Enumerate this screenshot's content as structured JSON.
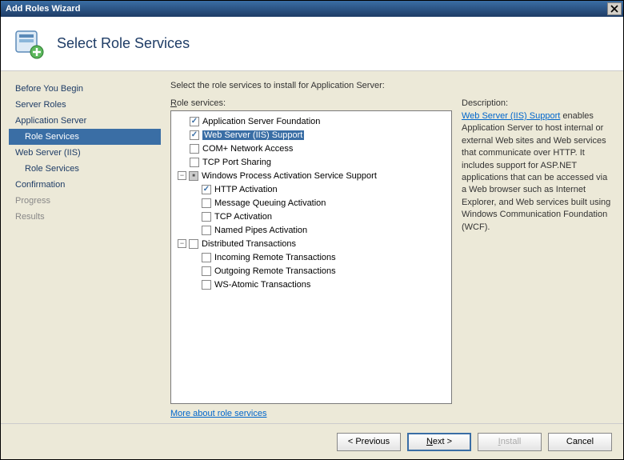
{
  "window": {
    "title": "Add Roles Wizard"
  },
  "header": {
    "title": "Select Role Services"
  },
  "sidebar": {
    "items": [
      {
        "label": "Before You Begin",
        "cls": ""
      },
      {
        "label": "Server Roles",
        "cls": ""
      },
      {
        "label": "Application Server",
        "cls": ""
      },
      {
        "label": "Role Services",
        "cls": "selected sub"
      },
      {
        "label": "Web Server (IIS)",
        "cls": ""
      },
      {
        "label": "Role Services",
        "cls": "sub"
      },
      {
        "label": "Confirmation",
        "cls": ""
      },
      {
        "label": "Progress",
        "cls": "gray"
      },
      {
        "label": "Results",
        "cls": "gray"
      }
    ]
  },
  "main": {
    "instruction": "Select the role services to install for Application Server:",
    "tree_label_pre": "R",
    "tree_label_post": "ole services:",
    "desc_label": "Description:",
    "desc_link": "Web Server (IIS) Support",
    "desc_text": " enables Application Server to host internal or external Web sites and Web services that communicate over HTTP. It includes support for ASP.NET applications that can be accessed via a Web browser such as Internet Explorer, and Web services built using Windows Communication Foundation (WCF).",
    "more_link": "More about role services",
    "tree": [
      {
        "label": "Application Server Foundation",
        "indent": "indent1",
        "check": "checked",
        "exp": "space"
      },
      {
        "label": "Web Server (IIS) Support",
        "indent": "indent1",
        "check": "checked",
        "exp": "space",
        "highlight": true
      },
      {
        "label": "COM+ Network Access",
        "indent": "indent1",
        "check": "",
        "exp": "space"
      },
      {
        "label": "TCP Port Sharing",
        "indent": "indent1",
        "check": "",
        "exp": "space"
      },
      {
        "label": "Windows Process Activation Service Support",
        "indent": "",
        "check": "indeterminate",
        "exp": "minus"
      },
      {
        "label": "HTTP Activation",
        "indent": "indent2",
        "check": "checked",
        "exp": "space"
      },
      {
        "label": "Message Queuing Activation",
        "indent": "indent2",
        "check": "",
        "exp": "space"
      },
      {
        "label": "TCP Activation",
        "indent": "indent2",
        "check": "",
        "exp": "space"
      },
      {
        "label": "Named Pipes Activation",
        "indent": "indent2",
        "check": "",
        "exp": "space"
      },
      {
        "label": "Distributed Transactions",
        "indent": "",
        "check": "",
        "exp": "minus"
      },
      {
        "label": "Incoming Remote Transactions",
        "indent": "indent2",
        "check": "",
        "exp": "space"
      },
      {
        "label": "Outgoing Remote Transactions",
        "indent": "indent2",
        "check": "",
        "exp": "space"
      },
      {
        "label": "WS-Atomic Transactions",
        "indent": "indent2",
        "check": "",
        "exp": "space"
      }
    ]
  },
  "footer": {
    "previous": "< Previous",
    "next_pre": "N",
    "next_post": "ext >",
    "install": "Install",
    "cancel": "Cancel"
  }
}
